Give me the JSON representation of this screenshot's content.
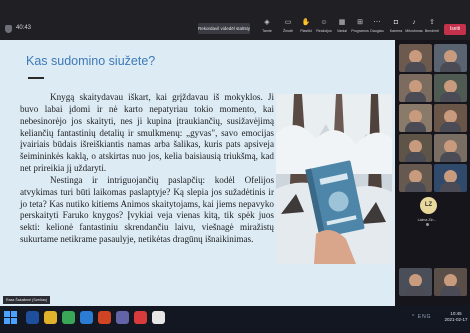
{
  "meeting": {
    "timer": "40:43",
    "stop_recording": "Rekordavil videdēl stalīsty",
    "leave_label": "Iseiti",
    "toolbar": [
      {
        "label": "Tamte",
        "icon": "shield-icon"
      },
      {
        "label": "Žinutė",
        "icon": "chat-icon"
      },
      {
        "label": "Plastikt",
        "icon": "hand-icon"
      },
      {
        "label": "Reakcijos",
        "icon": "smile-icon"
      },
      {
        "label": "Vardai",
        "icon": "grid-icon"
      },
      {
        "label": "Programos",
        "icon": "apps-icon"
      },
      {
        "label": "Daugiau",
        "icon": "more-icon"
      },
      {
        "label": "Kamera",
        "icon": "camera-icon"
      },
      {
        "label": "Mikrofonas",
        "icon": "mic-icon"
      },
      {
        "label": "Bendrinti",
        "icon": "share-icon"
      }
    ]
  },
  "slide": {
    "title": "Kas sudomino siužete?",
    "paragraphs": [
      "Knygą skaitydavau iškart, kai grįždavau iš mokyklos. Ji buvo labai įdomi ir nė karto nepatyriau tokio momento, kai nebesinorėjo jos skaityti, nes ji kupina įtraukiančių, susižavėjimą keliančių fantastinių detalių ir smulkmenų: „gyvas\", savo emocijas įvairiais būdais išreiškiantis namas arba šalikas, kuris pats apsiveja šeimininkės kaklą, o atskirtas nuo jos, kelia baisiausią triukšmą, kad net prireikia jį uždaryti.",
      "Nestinga ir intriguojančių paslapčių: kodėl Ofelijos atvykimas turi būti laikomas paslaptyje? Ką slepia jos sužadėtinis ir jo teta? Kas nutiko kitiems Animos skaitytojams, kai jiems nepavyko perskaityti Faruko knygos? Įvykiai veja vienas kitą, tik spėk juos sekti: kelionė fantastiniu skrendančiu laivu, viešnagė miražistų sukurtame netikrame pasaulyje, netikėtas dragūnų išnaikinimas."
    ],
    "presenter_tag": "Rasa Šakalienė (Svečias)"
  },
  "participants": {
    "avatar_initials": "LZ",
    "avatar_name": "Laima Zin..."
  },
  "taskbar": {
    "tray": "^ ENG",
    "time": "10:45",
    "date": "2021-02-17"
  }
}
